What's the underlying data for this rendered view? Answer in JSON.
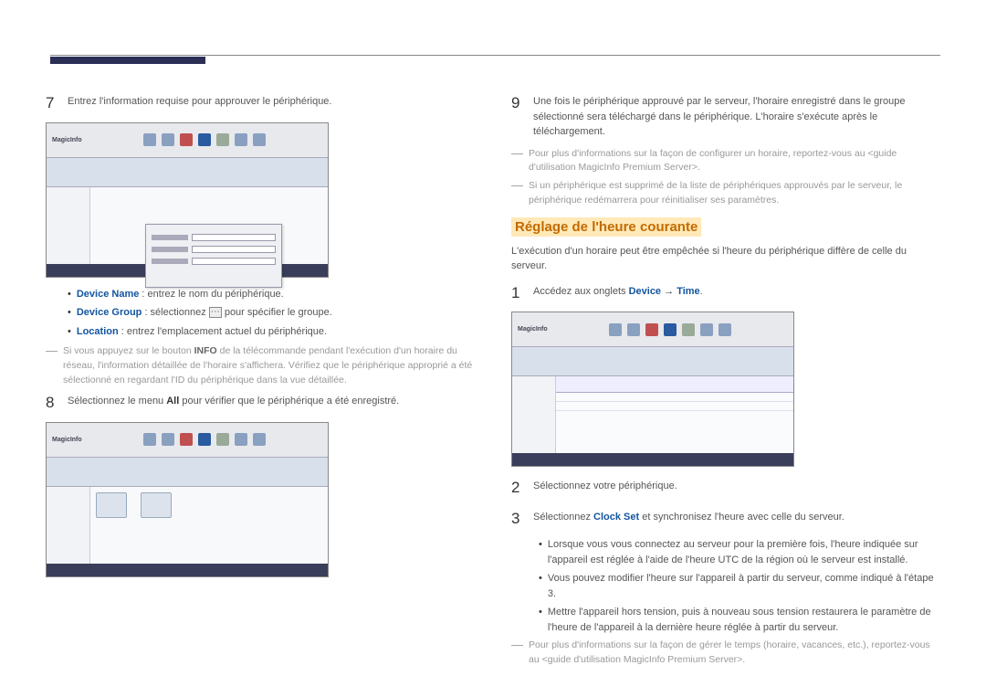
{
  "header": {},
  "left": {
    "step7": {
      "num": "7",
      "text": "Entrez l'information requise pour approuver le périphérique."
    },
    "defs": {
      "deviceName": {
        "term": "Device Name",
        "text": " : entrez le nom du périphérique."
      },
      "deviceGroup": {
        "term": "Device Group",
        "pre": " : sélectionnez ",
        "post": " pour spécifier le groupe."
      },
      "location": {
        "term": "Location",
        "text": " : entrez l'emplacement actuel du périphérique."
      }
    },
    "note1": {
      "pre": "Si vous appuyez sur le bouton ",
      "bold": "INFO",
      "post": " de la télécommande pendant l'exécution d'un horaire du réseau, l'information détaillée de l'horaire s'affichera. Vérifiez que le périphérique approprié a été sélectionné en regardant l'ID du périphérique dans la vue détaillée."
    },
    "step8": {
      "num": "8",
      "pre": "Sélectionnez le menu ",
      "bold": "All",
      "post": " pour vérifier que le périphérique a été enregistré."
    }
  },
  "right": {
    "step9": {
      "num": "9",
      "text": "Une fois le périphérique approuvé par le serveur, l'horaire enregistré dans le groupe sélectionné sera téléchargé dans le périphérique. L'horaire s'exécute après le téléchargement."
    },
    "note2": "Pour plus d'informations sur la façon de configurer un horaire, reportez-vous au <guide d'utilisation MagicInfo Premium Server>.",
    "note3": "Si un périphérique est supprimé de la liste de périphériques approuvés par le serveur, le périphérique redémarrera pour réinitialiser ses paramètres.",
    "heading": "Réglage de l'heure courante",
    "intro": "L'exécution d'un horaire peut être empêchée si l'heure du périphérique diffère de celle du serveur.",
    "step1": {
      "num": "1",
      "pre": "Accédez aux onglets ",
      "link1": "Device",
      "arrow": " → ",
      "link2": "Time",
      "post": "."
    },
    "step2": {
      "num": "2",
      "text": "Sélectionnez votre périphérique."
    },
    "step3": {
      "num": "3",
      "pre": "Sélectionnez ",
      "link": "Clock Set",
      "post": " et synchronisez l'heure avec celle du serveur."
    },
    "bullets": {
      "b1": "Lorsque vous vous connectez au serveur pour la première fois, l'heure indiquée sur l'appareil est réglée à l'aide de l'heure UTC de la région où le serveur est installé.",
      "b2": "Vous pouvez modifier l'heure sur l'appareil à partir du serveur, comme indiqué à l'étape 3.",
      "b3": "Mettre l'appareil hors tension, puis à nouveau sous tension restaurera le paramètre de l'heure de l'appareil à la dernière heure réglée à partir du serveur."
    },
    "note4": "Pour plus d'informations sur la façon de gérer le temps (horaire, vacances, etc.), reportez-vous au <guide d'utilisation MagicInfo Premium Server>."
  },
  "ss": {
    "logo": "MagicInfo"
  }
}
